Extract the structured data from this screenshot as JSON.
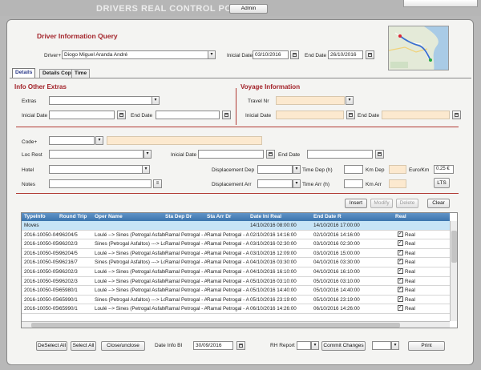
{
  "app": {
    "title": "DRIVERS REAL CONTROL POINT",
    "admin_label": "Admin"
  },
  "query": {
    "title": "Driver Information Query",
    "driver_label": "Driver+",
    "driver_value": "Diogo Miguel Aranda André",
    "initial_date_label": "Inicial Date",
    "initial_date_value": "03/10/2016",
    "end_date_label": "End Date",
    "end_date_value": "26/10/2016"
  },
  "tabs": [
    {
      "label": "Details",
      "active": true
    },
    {
      "label": "Details Cop",
      "active": false
    },
    {
      "label": "Time",
      "active": false
    }
  ],
  "info_extras": {
    "title": "Info Other Extras",
    "extras_label": "Extras",
    "inicial_date_label": "Inicial Date",
    "end_date_label": "End Date"
  },
  "voyage": {
    "title": "Voyage Information",
    "travel_nr_label": "Travel Nr",
    "inicial_date_label": "Inicial Date",
    "end_date_label": "End Date"
  },
  "form": {
    "code_label": "Code+",
    "loc_rest_label": "Loc Rest",
    "inicial_date_label": "Inicial Date",
    "end_date_label": "End Date",
    "hotel_label": "Hotel",
    "notes_label": "Notes",
    "displacement_dep_label": "Displacement Dep",
    "displacement_arr_label": "Displacement Arr",
    "time_dep_label": "Time Dep (h)",
    "time_arr_label": "Time Arr (h)",
    "km_dep_label": "Km Dep",
    "km_arr_label": "Km Arr",
    "euro_km_label": "Euro/Km",
    "euro_km_value": "0.25 €",
    "lts_label": "LTS"
  },
  "actions": {
    "insert": "Insert",
    "modify": "Modify",
    "delete": "Delete",
    "clear": "Clear"
  },
  "table": {
    "columns": [
      "TypeInfo",
      "Round Trip",
      "Oper Name",
      "Sta Dep Dr",
      "Sta Arr Dr",
      "Date Ini Real",
      "End Date R",
      "Real"
    ],
    "rows": [
      [
        "Moves",
        "",
        "",
        "",
        "",
        "14/10/2016 08:00:00",
        "14/10/2016 17:00:00",
        ""
      ],
      [
        "2016-10050-049",
        "96204/5",
        "Loulé --> Sines (Petrogal Asfaltos) ---> Lou",
        "Ramal Petrogal - A",
        "Ramal Petrogal - A",
        "02/10/2016 14:16:00",
        "02/10/2016 14:16:00",
        "Real"
      ],
      [
        "2016-10050-050",
        "96202/3",
        "Sines (Petrogal Asfaltos) ---> Loulé --> Sir",
        "Ramal Petrogal - A",
        "Ramal Petrogal - A",
        "03/10/2016 02:30:00",
        "03/10/2016 02:30:00",
        "Real"
      ],
      [
        "2016-10050-050",
        "96204/5",
        "Loulé --> Sines (Petrogal Asfaltos) ---> Lou",
        "Ramal Petrogal - A",
        "Ramal Petrogal - A",
        "03/10/2016 12:09:00",
        "03/10/2016 15:00:00",
        "Real"
      ],
      [
        "2016-10050-050",
        "96216/7",
        "Sines (Petrogal Asfaltos) ---> Loulé --> Sir",
        "Ramal Petrogal - A",
        "Ramal Petrogal - A",
        "04/10/2016 03:30:00",
        "04/10/2016 03:30:00",
        "Real"
      ],
      [
        "2016-10050-050",
        "96202/3",
        "Loulé --> Sines (Petrogal Asfaltos) ---> Lou",
        "Ramal Petrogal - A",
        "Ramal Petrogal - A",
        "04/10/2016 16:10:00",
        "04/10/2016 16:10:00",
        "Real"
      ],
      [
        "2016-10050-050",
        "96202/3",
        "Loulé --> Sines (Petrogal Asfaltos) ---> Lou",
        "Ramal Petrogal - A",
        "Ramal Petrogal - A",
        "05/10/2016 03:10:00",
        "05/10/2016 03:10:00",
        "Real"
      ],
      [
        "2016-10050-050",
        "65980/1",
        "Loulé --> Sines (Petrogal Asfaltos) ---> Lou",
        "Ramal Petrogal - A",
        "Ramal Petrogal - A",
        "05/10/2016 14:40:00",
        "05/10/2016 14:40:00",
        "Real"
      ],
      [
        "2016-10050-050",
        "65990/1",
        "Sines (Petrogal Asfaltos) ---> Loulé --> Sir",
        "Ramal Petrogal - A",
        "Ramal Petrogal - A",
        "05/10/2016 23:19:00",
        "05/10/2016 23:19:00",
        "Real"
      ],
      [
        "2016-10050-050",
        "65990/1",
        "Loulé --> Sines (Petrogal Asfaltos) ---> Lou",
        "Ramal Petrogal - A",
        "Ramal Petrogal - A",
        "06/10/2016 14:26:00",
        "06/10/2016 14:26:00",
        "Real"
      ]
    ]
  },
  "footer": {
    "deselect_all": "DeSelect All",
    "select_all": "Select All",
    "close_unclose": "Close/unclose",
    "date_info_label": "Date Info BI",
    "date_info_value": "30/09/2016",
    "rh_report_label": "RH Report",
    "commit_changes": "Commit Changes",
    "print": "Print"
  },
  "colors": {
    "section_title": "#a3232a",
    "grid_header": "#4a80b8",
    "selected_row": "#c7e4f6",
    "readonly_field": "#fce9cf"
  }
}
